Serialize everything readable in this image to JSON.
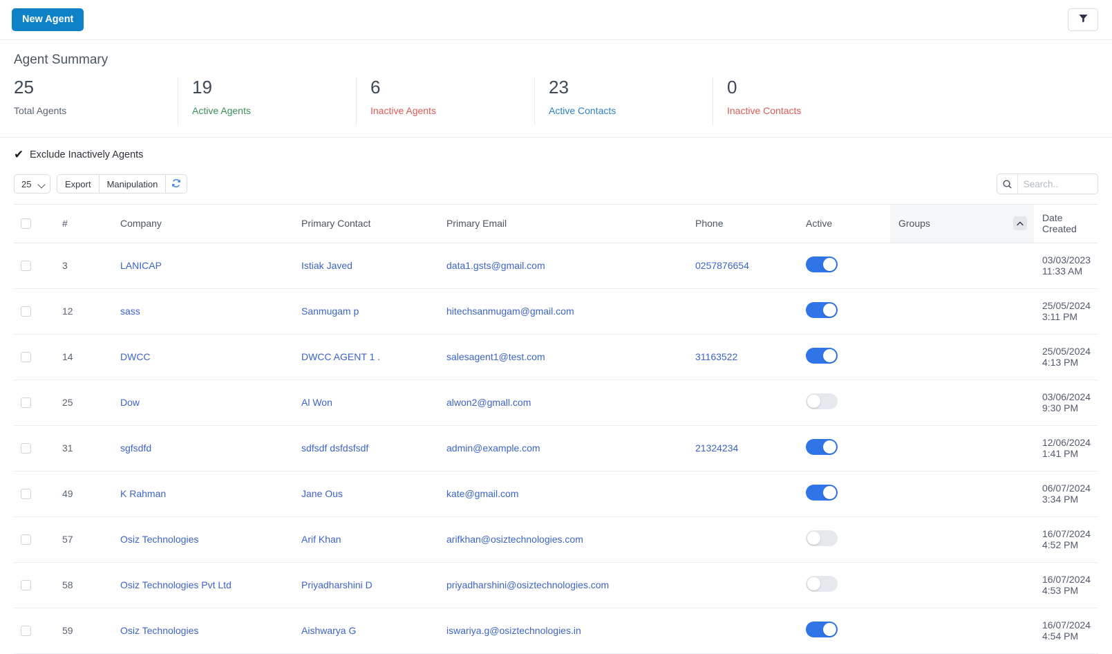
{
  "topbar": {
    "new_agent_label": "New Agent",
    "filter_icon": "filter-funnel-icon"
  },
  "summary": {
    "title": "Agent Summary",
    "cards": [
      {
        "value": "25",
        "label": "Total Agents",
        "tone": "neutral"
      },
      {
        "value": "19",
        "label": "Active Agents",
        "tone": "green"
      },
      {
        "value": "6",
        "label": "Inactive Agents",
        "tone": "red"
      },
      {
        "value": "23",
        "label": "Active Contacts",
        "tone": "blue"
      },
      {
        "value": "0",
        "label": "Inactive Contacts",
        "tone": "red"
      }
    ]
  },
  "controls": {
    "exclude_checkbox_label": "Exclude Inactively Agents",
    "exclude_checkbox_checked": true,
    "checkmark_glyph": "✔",
    "page_size_value": "25",
    "page_size_options": [
      "25"
    ],
    "export_label": "Export",
    "manipulation_label": "Manipulation",
    "refresh_icon": "refresh-icon",
    "search_placeholder": "Search..",
    "search_value": "",
    "search_icon": "search-icon"
  },
  "table": {
    "columns": [
      "#",
      "Company",
      "Primary Contact",
      "Primary Email",
      "Phone",
      "Active",
      "Groups",
      "Date Created"
    ],
    "sorted_column": "Groups",
    "sort_direction": "asc",
    "rows": [
      {
        "num": "3",
        "company": "LANICAP",
        "contact": "Istiak Javed",
        "email": "data1.gsts@gmail.com",
        "phone": "0257876654",
        "active": true,
        "groups": "",
        "date": "03/03/2023 11:33 AM"
      },
      {
        "num": "12",
        "company": "sass",
        "contact": "Sanmugam p",
        "email": "hitechsanmugam@gmail.com",
        "phone": "",
        "active": true,
        "groups": "",
        "date": "25/05/2024 3:11 PM"
      },
      {
        "num": "14",
        "company": "DWCC",
        "contact": "DWCC AGENT 1 .",
        "email": "salesagent1@test.com",
        "phone": "31163522",
        "active": true,
        "groups": "",
        "date": "25/05/2024 4:13 PM"
      },
      {
        "num": "25",
        "company": "Dow",
        "contact": "Al Won",
        "email": "alwon2@gmall.com",
        "phone": "",
        "active": false,
        "groups": "",
        "date": "03/06/2024 9:30 PM"
      },
      {
        "num": "31",
        "company": "sgfsdfd",
        "contact": "sdfsdf dsfdsfsdf",
        "email": "admin@example.com",
        "phone": "21324234",
        "active": true,
        "groups": "",
        "date": "12/06/2024 1:41 PM"
      },
      {
        "num": "49",
        "company": "K Rahman",
        "contact": "Jane Ous",
        "email": "kate@gmail.com",
        "phone": "",
        "active": true,
        "groups": "",
        "date": "06/07/2024 3:34 PM"
      },
      {
        "num": "57",
        "company": "Osiz Technologies",
        "contact": "Arif Khan",
        "email": "arifkhan@osiztechnologies.com",
        "phone": "",
        "active": false,
        "groups": "",
        "date": "16/07/2024 4:52 PM"
      },
      {
        "num": "58",
        "company": "Osiz Technologies Pvt Ltd",
        "contact": "Priyadharshini D",
        "email": "priyadharshini@osiztechnologies.com",
        "phone": "",
        "active": false,
        "groups": "",
        "date": "16/07/2024 4:53 PM"
      },
      {
        "num": "59",
        "company": "Osiz Technologies",
        "contact": "Aishwarya G",
        "email": "iswariya.g@osiztechnologies.in",
        "phone": "",
        "active": true,
        "groups": "",
        "date": "16/07/2024 4:54 PM"
      }
    ]
  },
  "colors": {
    "primary_button": "#0f81c7",
    "link": "#3b63c9",
    "toggle_on": "#2f75e8",
    "toggle_off": "#e5e8ec",
    "green": "#3c8e5b",
    "red": "#e05b55",
    "blue": "#2f7fc4"
  }
}
